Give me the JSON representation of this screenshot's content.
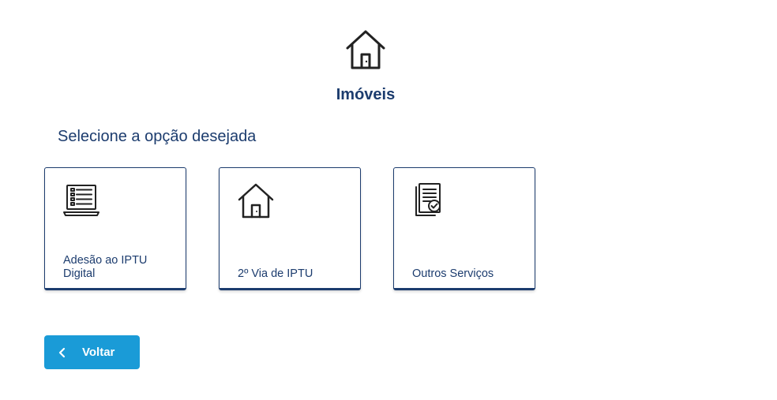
{
  "header": {
    "icon": "house-icon",
    "title": "Imóveis"
  },
  "main": {
    "subtitle": "Selecione a opção desejada",
    "cards": [
      {
        "icon": "laptop-list-icon",
        "label": "Adesão ao IPTU Digital"
      },
      {
        "icon": "house-icon",
        "label": "2º Via de IPTU"
      },
      {
        "icon": "document-check-icon",
        "label": "Outros Serviços"
      }
    ]
  },
  "footer": {
    "back_icon": "chevron-left-icon",
    "back_label": "Voltar"
  },
  "colors": {
    "primary_text": "#1c3c6e",
    "button": "#1a9bd7"
  }
}
